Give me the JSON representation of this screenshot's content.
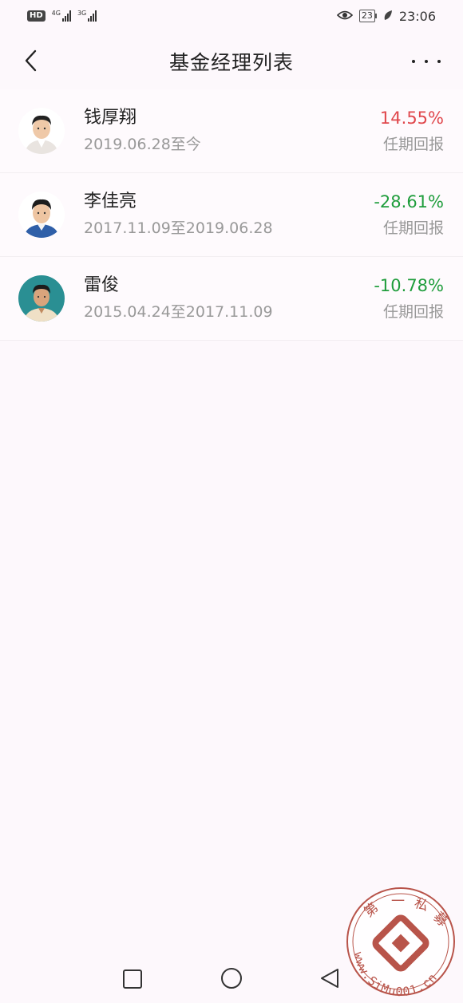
{
  "status_bar": {
    "hd_label": "HD",
    "net1": "4G",
    "net2": "3G",
    "battery": "23",
    "time": "23:06"
  },
  "header": {
    "title": "基金经理列表"
  },
  "managers": [
    {
      "name": "钱厚翔",
      "period": "2019.06.28至今",
      "return": "14.55%",
      "return_label": "任期回报"
    },
    {
      "name": "李佳亮",
      "period": "2017.11.09至2019.06.28",
      "return": "-28.61%",
      "return_label": "任期回报"
    },
    {
      "name": "雷俊",
      "period": "2015.04.24至2017.11.09",
      "return": "-10.78%",
      "return_label": "任期回报"
    }
  ],
  "watermark": {
    "chars": [
      "第",
      "一",
      "私",
      "募"
    ],
    "url": "www.SiMu001.cn"
  },
  "colors": {
    "positive": "#e0474c",
    "negative": "#1f9d3c",
    "watermark": "#b8544a"
  }
}
